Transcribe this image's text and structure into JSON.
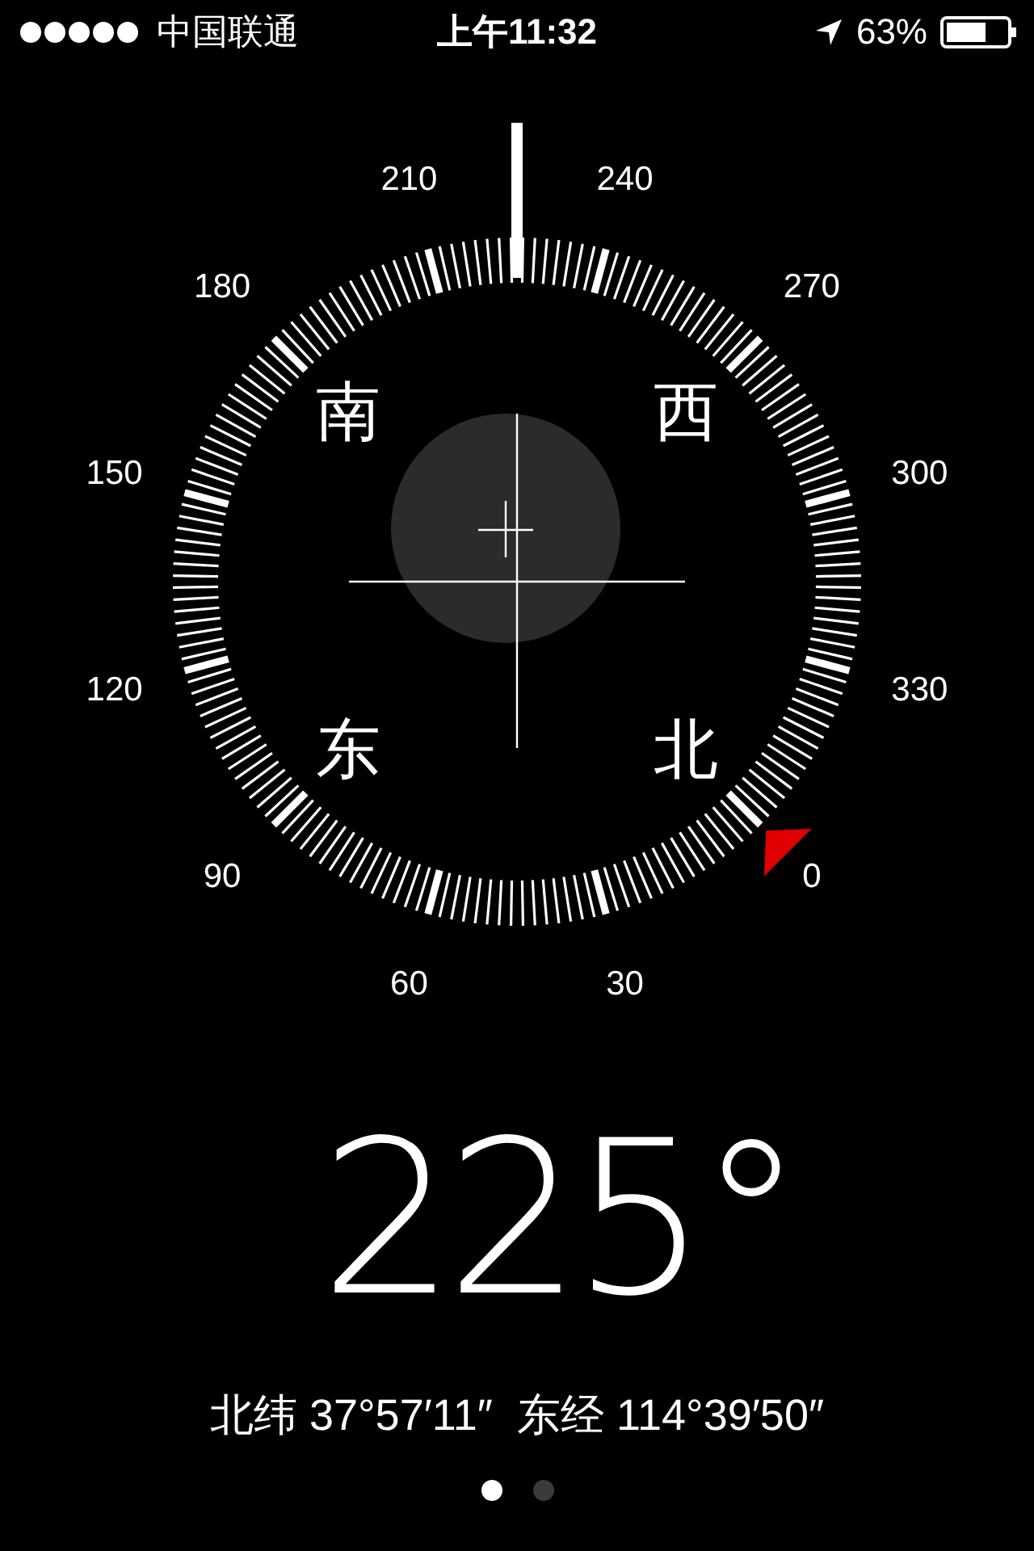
{
  "status_bar": {
    "carrier": "中国联通",
    "time": "上午11:32",
    "battery_percent": "63%"
  },
  "compass": {
    "heading": "225°",
    "degree_labels": [
      "0",
      "30",
      "60",
      "90",
      "120",
      "150",
      "180",
      "210",
      "240",
      "270",
      "300",
      "330"
    ],
    "cardinals": [
      "南",
      "西",
      "东",
      "北"
    ]
  },
  "coordinates": "北纬 37°57′11″  东经 114°39′50″",
  "pages": [
    {
      "selected": true
    },
    {
      "selected": false
    }
  ]
}
